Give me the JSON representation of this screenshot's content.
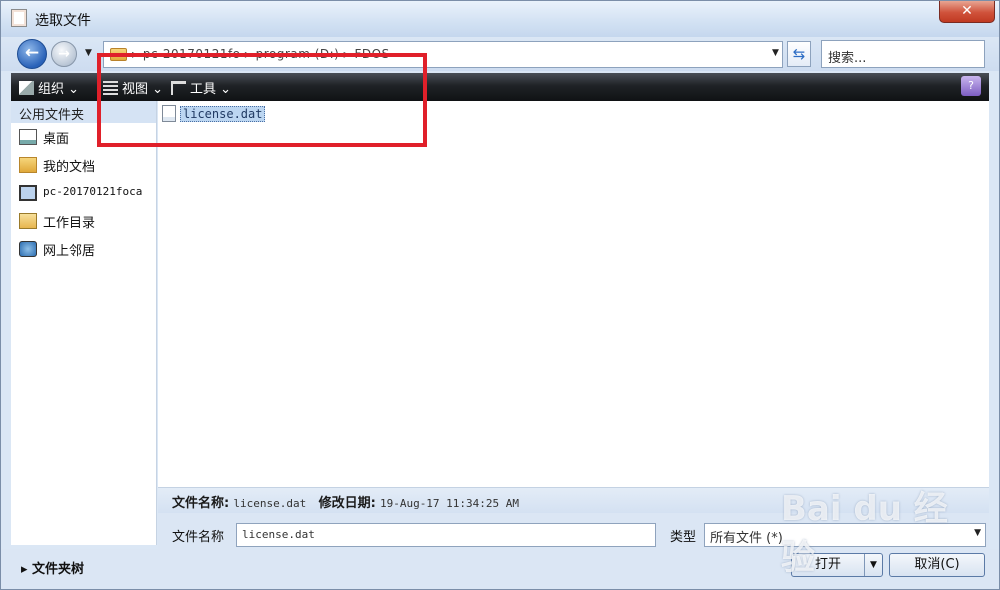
{
  "window": {
    "title": "选取文件",
    "close_label": "✕"
  },
  "nav": {
    "back_label": "←",
    "forward_label": "→",
    "history_label": "▼",
    "address_path": "▸ pc-20170121fo ▸ program (D:) ▸ FDOS",
    "address_dropdown": "▼",
    "refresh_label": "⇆",
    "search_placeholder": "搜索..."
  },
  "toolbar": {
    "organize_label": "组织 ⌄",
    "views_label": "视图 ⌄",
    "tools_label": "工具 ⌄",
    "help_label": "?"
  },
  "sidebar": {
    "header": "公用文件夹",
    "items": [
      {
        "label": "桌面",
        "icon": "desktop-icon"
      },
      {
        "label": "我的文档",
        "icon": "documents-icon"
      },
      {
        "label": "pc-20170121foca",
        "icon": "computer-icon"
      },
      {
        "label": "工作目录",
        "icon": "work-folder-icon"
      },
      {
        "label": "网上邻居",
        "icon": "network-icon"
      }
    ]
  },
  "files": [
    {
      "name": "license.dat",
      "icon": "file-icon",
      "selected": true
    }
  ],
  "details": {
    "name_label": "文件名称:",
    "name_value": "license.dat",
    "date_label": "修改日期:",
    "date_value": "19-Aug-17 11:34:25 AM"
  },
  "form": {
    "filename_label": "文件名称",
    "filename_value": "license.dat",
    "type_label": "类型",
    "type_value": "所有文件 (*)"
  },
  "footer": {
    "folders_label": "▸ 文件夹树",
    "open_label": "打开",
    "open_split": "▼",
    "cancel_label": "取消(C)"
  },
  "watermark": "Bai du 经验",
  "colors": {
    "highlight": "#e0202a",
    "toolbar": "#1f2226",
    "accent": "#2a62b8"
  }
}
